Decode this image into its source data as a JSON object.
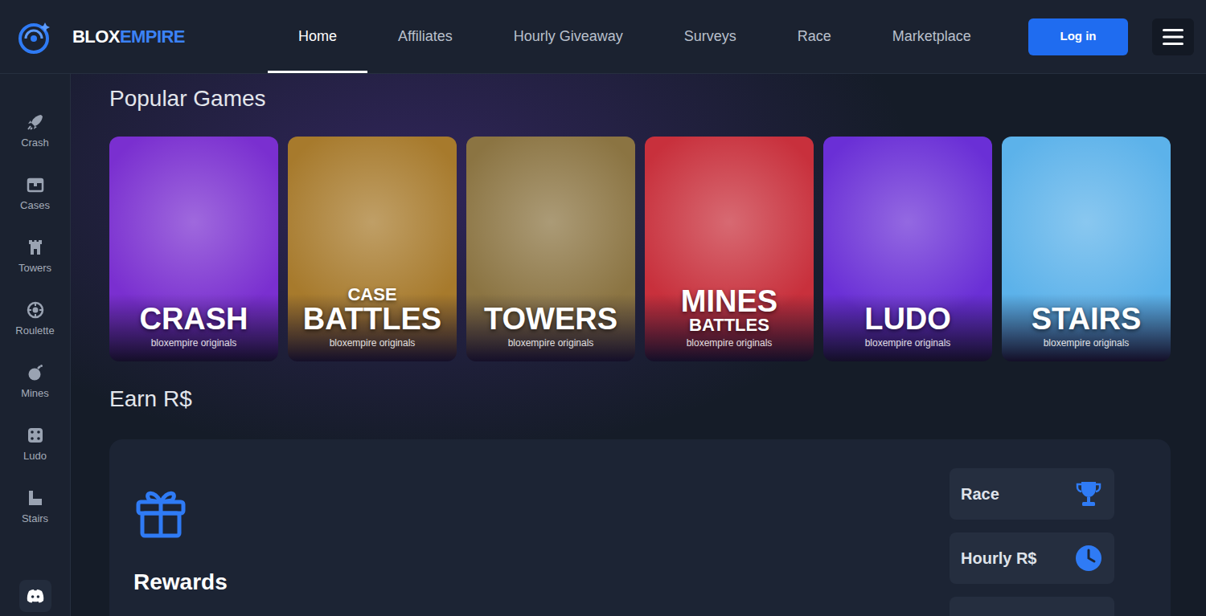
{
  "logo": {
    "first": "BLOX",
    "second": "EMPIRE"
  },
  "nav": [
    {
      "label": "Home",
      "selected": true
    },
    {
      "label": "Affiliates",
      "selected": false
    },
    {
      "label": "Hourly Giveaway",
      "selected": false
    },
    {
      "label": "Surveys",
      "selected": false
    },
    {
      "label": "Race",
      "selected": false
    },
    {
      "label": "Marketplace",
      "selected": false
    }
  ],
  "login": "Log in",
  "sidebar": {
    "items": [
      {
        "label": "Crash"
      },
      {
        "label": "Cases"
      },
      {
        "label": "Towers"
      },
      {
        "label": "Roulette"
      },
      {
        "label": "Mines"
      },
      {
        "label": "Ludo"
      },
      {
        "label": "Stairs"
      }
    ]
  },
  "popular": {
    "title": "Popular Games",
    "games": [
      {
        "lines": [
          {
            "text": "CRASH",
            "kind": "big"
          }
        ],
        "subtitle": "bloxempire originals",
        "color": "#7a2fd0"
      },
      {
        "lines": [
          {
            "text": "CASE",
            "kind": "small"
          },
          {
            "text": "BATTLES",
            "kind": "big"
          }
        ],
        "subtitle": "bloxempire originals",
        "color": "#a77a2c"
      },
      {
        "lines": [
          {
            "text": "TOWERS",
            "kind": "big"
          }
        ],
        "subtitle": "bloxempire originals",
        "color": "#8b7442"
      },
      {
        "lines": [
          {
            "text": "MINES",
            "kind": "big"
          },
          {
            "text": "BATTLES",
            "kind": "small"
          }
        ],
        "subtitle": "bloxempire originals",
        "color": "#c8303c"
      },
      {
        "lines": [
          {
            "text": "LUDO",
            "kind": "big"
          }
        ],
        "subtitle": "bloxempire originals",
        "color": "#6a2fd6"
      },
      {
        "lines": [
          {
            "text": "STAIRS",
            "kind": "big"
          }
        ],
        "subtitle": "bloxempire originals",
        "color": "#5cb2ea"
      }
    ]
  },
  "earn": {
    "title": "Earn R$",
    "rewards": {
      "title": "Rewards"
    },
    "links": [
      {
        "label": "Race"
      },
      {
        "label": "Hourly R$"
      }
    ]
  }
}
